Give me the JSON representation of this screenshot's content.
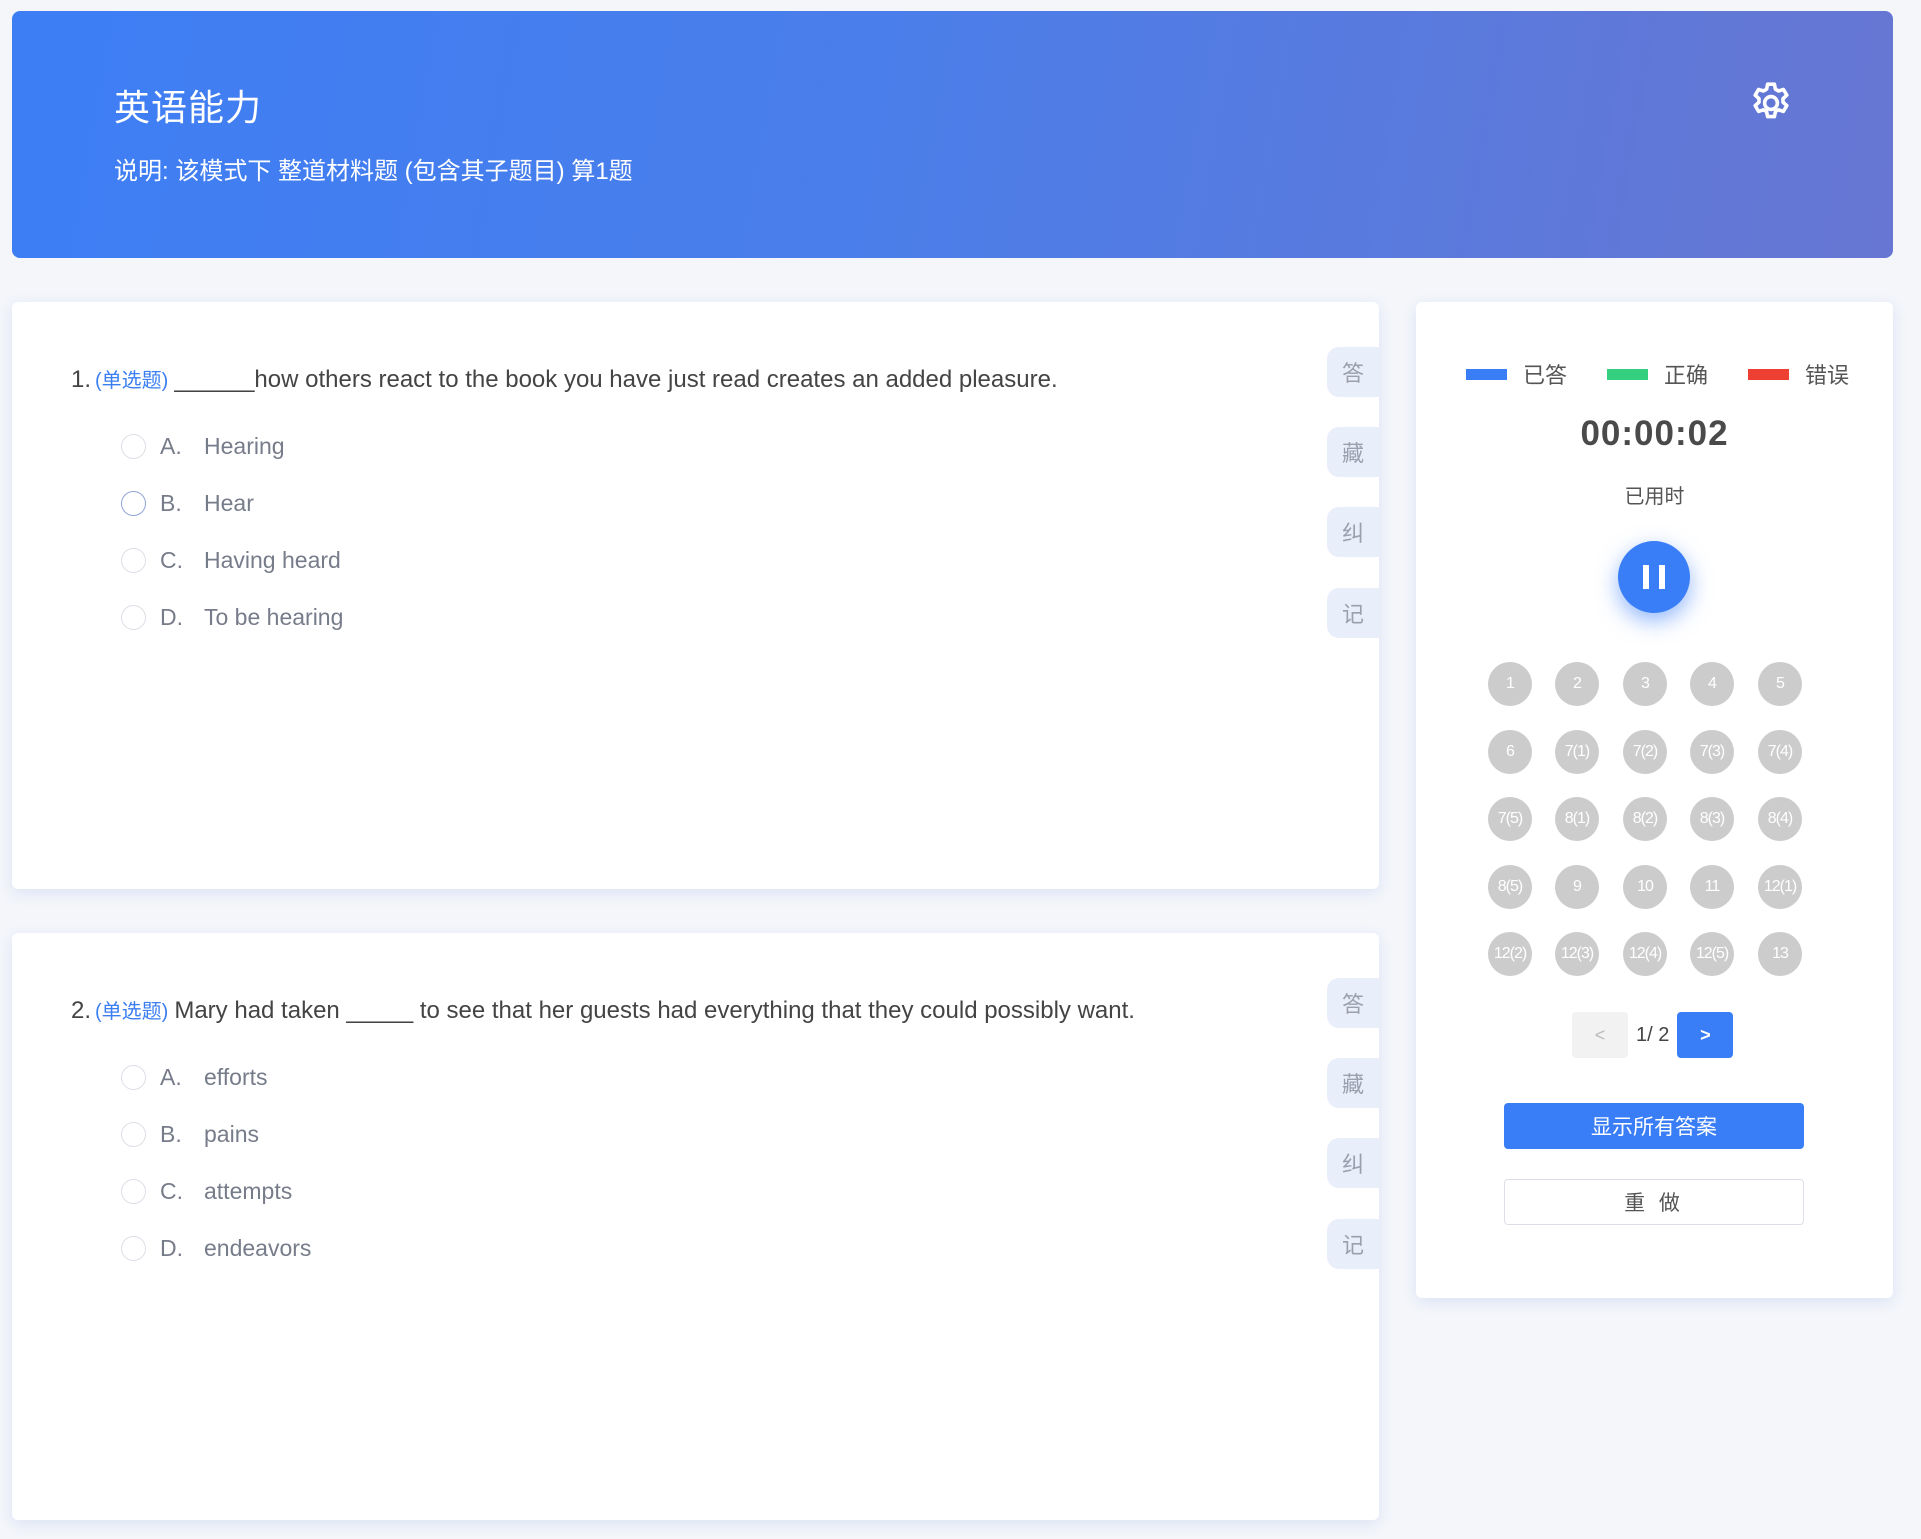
{
  "header": {
    "title": "英语能力",
    "description": "说明:  该模式下 整道材料题 (包含其子题目) 算1题",
    "settings_icon": "gear-icon"
  },
  "questions": [
    {
      "number": "1.",
      "type": "(单选题)",
      "stem": "______how others react to the book you have just read creates an added pleasure.",
      "options": [
        {
          "letter": "A.",
          "text": "Hearing"
        },
        {
          "letter": "B.",
          "text": "Hear"
        },
        {
          "letter": "C.",
          "text": "Having heard"
        },
        {
          "letter": "D.",
          "text": "To be hearing"
        }
      ],
      "actions": [
        "答",
        "藏",
        "纠",
        "记"
      ]
    },
    {
      "number": "2.",
      "type": "(单选题)",
      "stem": "Mary had taken _____ to see that her guests had everything that they could possibly want.",
      "options": [
        {
          "letter": "A.",
          "text": "efforts"
        },
        {
          "letter": "B.",
          "text": "pains"
        },
        {
          "letter": "C.",
          "text": "attempts"
        },
        {
          "letter": "D.",
          "text": "endeavors"
        }
      ],
      "actions": [
        "答",
        "藏",
        "纠",
        "记"
      ]
    }
  ],
  "panel": {
    "legend": [
      {
        "label": "已答",
        "color": "#3a7ef7"
      },
      {
        "label": "正确",
        "color": "#34d07f"
      },
      {
        "label": "错误",
        "color": "#ee3f33"
      }
    ],
    "timer": "00:00:02",
    "timer_label": "已用时",
    "pause_icon": "pause-icon",
    "question_numbers": [
      "1",
      "2",
      "3",
      "4",
      "5",
      "6",
      "7(1)",
      "7(2)",
      "7(3)",
      "7(4)",
      "7(5)",
      "8(1)",
      "8(2)",
      "8(3)",
      "8(4)",
      "8(5)",
      "9",
      "10",
      "11",
      "12(1)",
      "12(2)",
      "12(3)",
      "12(4)",
      "12(5)",
      "13"
    ],
    "pager": {
      "prev": "<",
      "text": "1/ 2",
      "next": ">"
    },
    "show_answers_label": "显示所有答案",
    "redo_label": "重 做"
  },
  "colors": {
    "accent": "#3a7ef7",
    "header_gradient_start": "#3d7ef5",
    "header_gradient_end": "#6776d2",
    "number_cell": "#cccccc"
  }
}
